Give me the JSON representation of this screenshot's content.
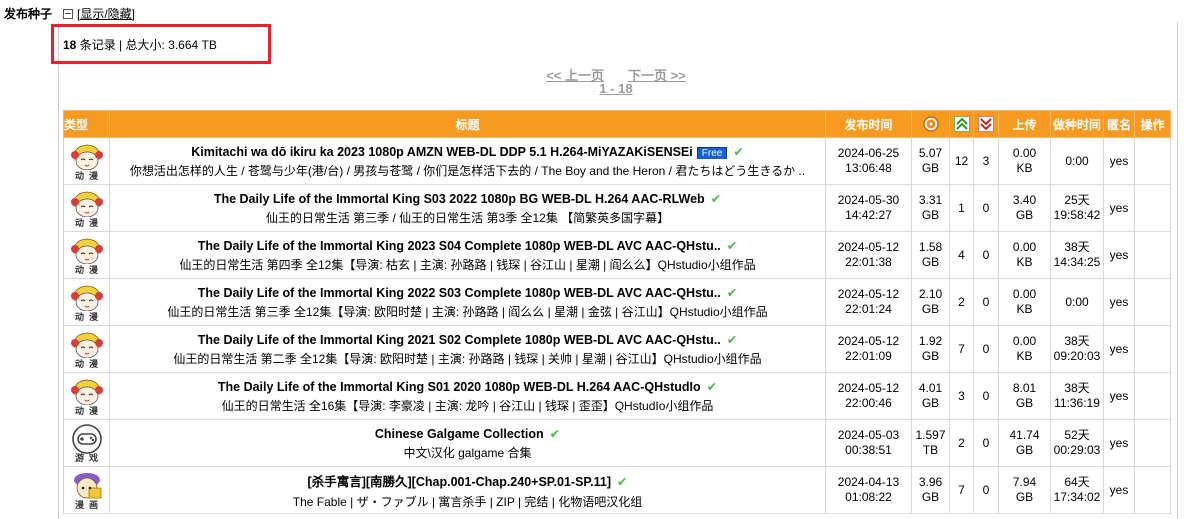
{
  "side_label": "发布种子",
  "toggle_label": "[显示/隐藏]",
  "summary": {
    "count": "18",
    "rest": " 条记录 | 总大小: 3.664 TB"
  },
  "pager": {
    "prev": "<< 上一页",
    "next": "下一页 >>",
    "range": "1 - 18"
  },
  "headers": {
    "type": "类型",
    "title": "标题",
    "time": "发布时间",
    "up": "上传",
    "seedtime": "做种时间",
    "anon": "匿名",
    "ops": "操作"
  },
  "header_icons": [
    "size-disc-icon",
    "seeders-up-icon",
    "leechers-down-icon"
  ],
  "rows": [
    {
      "category": "动漫",
      "title": "Kimitachi wa dō ikiru ka 2023 1080p AMZN WEB-DL DDP 5.1 H.264-MiYAZAKiSENSEi",
      "badge": "Free",
      "subtitle": "你想活出怎样的人生 / 苍鹭与少年(港/台) / 男孩与苍鹭 / 你们是怎样活下去的 / The Boy and the Heron / 君たちはどう生きるか ..",
      "date": "2024-06-25",
      "time": "13:06:48",
      "size_val": "5.07",
      "size_unit": "GB",
      "seeders": "12",
      "leechers": "3",
      "up_val": "0.00",
      "up_unit": "KB",
      "seed_a": "0:00",
      "seed_b": "",
      "anon": "yes"
    },
    {
      "category": "动漫",
      "title": "The Daily Life of the Immortal King S03 2022 1080p BG WEB-DL H.264 AAC-RLWeb",
      "badge": "",
      "subtitle": "仙王的日常生活 第三季 / 仙王的日常生活 第3季 全12集 【简繁英多国字幕】",
      "date": "2024-05-30",
      "time": "14:42:27",
      "size_val": "3.31",
      "size_unit": "GB",
      "seeders": "1",
      "leechers": "0",
      "up_val": "3.40",
      "up_unit": "GB",
      "seed_a": "25天",
      "seed_b": "19:58:42",
      "anon": "yes"
    },
    {
      "category": "动漫",
      "title": "The Daily Life of the Immortal King 2023 S04 Complete 1080p WEB-DL AVC AAC-QHstu..",
      "badge": "",
      "subtitle": "仙王的日常生活 第四季 全12集【导演: 枯玄 | 主演: 孙路路 | 钱琛 | 谷江山 | 星潮 | 阎么么】QHstudio小组作品",
      "date": "2024-05-12",
      "time": "22:01:38",
      "size_val": "1.58",
      "size_unit": "GB",
      "seeders": "4",
      "leechers": "0",
      "up_val": "0.00",
      "up_unit": "KB",
      "seed_a": "38天",
      "seed_b": "14:34:25",
      "anon": "yes"
    },
    {
      "category": "动漫",
      "title": "The Daily Life of the Immortal King 2022 S03 Complete 1080p WEB-DL AVC AAC-QHstu..",
      "badge": "",
      "subtitle": "仙王的日常生活 第三季 全12集【导演: 欧阳时楚 | 主演: 孙路路 | 阎么么 | 星潮 | 金弦 | 谷江山】QHstudio小组作品",
      "date": "2024-05-12",
      "time": "22:01:24",
      "size_val": "2.10",
      "size_unit": "GB",
      "seeders": "2",
      "leechers": "0",
      "up_val": "0.00",
      "up_unit": "KB",
      "seed_a": "0:00",
      "seed_b": "",
      "anon": "yes"
    },
    {
      "category": "动漫",
      "title": "The Daily Life of the Immortal King 2021 S02 Complete 1080p WEB-DL AVC AAC-QHstu..",
      "badge": "",
      "subtitle": "仙王的日常生活 第二季 全12集【导演: 欧阳时楚 | 主演: 孙路路 | 钱琛 | 关帅 | 星潮 | 谷江山】QHstudio小组作品",
      "date": "2024-05-12",
      "time": "22:01:09",
      "size_val": "1.92",
      "size_unit": "GB",
      "seeders": "7",
      "leechers": "0",
      "up_val": "0.00",
      "up_unit": "KB",
      "seed_a": "38天",
      "seed_b": "09:20:03",
      "anon": "yes"
    },
    {
      "category": "动漫",
      "title": "The Daily Life of the Immortal King S01 2020 1080p WEB-DL H.264 AAC-QHstudIo",
      "badge": "",
      "subtitle": "仙王的日常生活 全16集【导演: 李豪凌 | 主演: 龙吟 | 谷江山 | 钱琛 | 歪歪】QHstudIo小组作品",
      "date": "2024-05-12",
      "time": "22:00:46",
      "size_val": "4.01",
      "size_unit": "GB",
      "seeders": "3",
      "leechers": "0",
      "up_val": "8.01",
      "up_unit": "GB",
      "seed_a": "38天",
      "seed_b": "11:36:19",
      "anon": "yes"
    },
    {
      "category": "游戏",
      "title": "Chinese Galgame Collection",
      "badge": "",
      "subtitle": "中文\\汉化 galgame 合集",
      "date": "2024-05-03",
      "time": "00:38:51",
      "size_val": "1.597",
      "size_unit": "TB",
      "seeders": "2",
      "leechers": "0",
      "up_val": "41.74",
      "up_unit": "GB",
      "seed_a": "52天",
      "seed_b": "00:29:03",
      "anon": "yes"
    },
    {
      "category": "漫画",
      "title": "[杀手寓言][南勝久][Chap.001-Chap.240+SP.01-SP.11]",
      "badge": "",
      "subtitle": "The Fable | ザ・ファブル | 寓言杀手 | ZIP | 完结 | 化物语吧汉化组",
      "date": "2024-04-13",
      "time": "01:08:22",
      "size_val": "3.96",
      "size_unit": "GB",
      "seeders": "7",
      "leechers": "0",
      "up_val": "7.94",
      "up_unit": "GB",
      "seed_a": "64天",
      "seed_b": "17:34:02",
      "anon": "yes"
    }
  ]
}
